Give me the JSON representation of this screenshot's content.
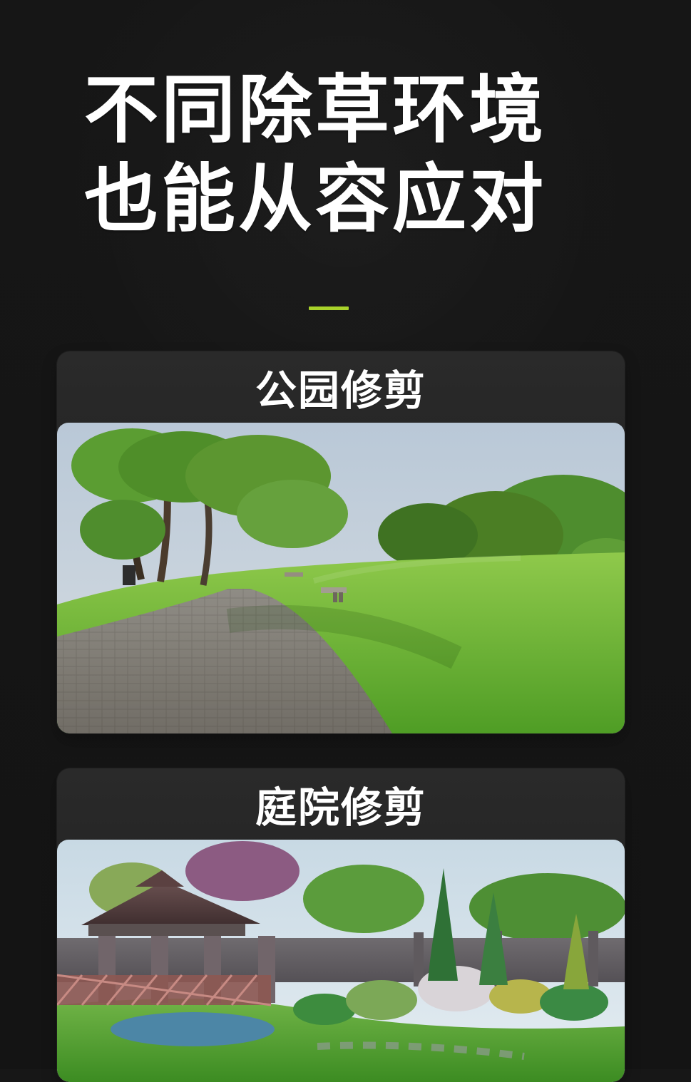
{
  "page": {
    "headline_line1": "不同除草环境",
    "headline_line2": "也能从容应对",
    "accent_color": "#a8d22a"
  },
  "sections": [
    {
      "title": "公园修剪"
    },
    {
      "title": "庭院修剪"
    }
  ]
}
